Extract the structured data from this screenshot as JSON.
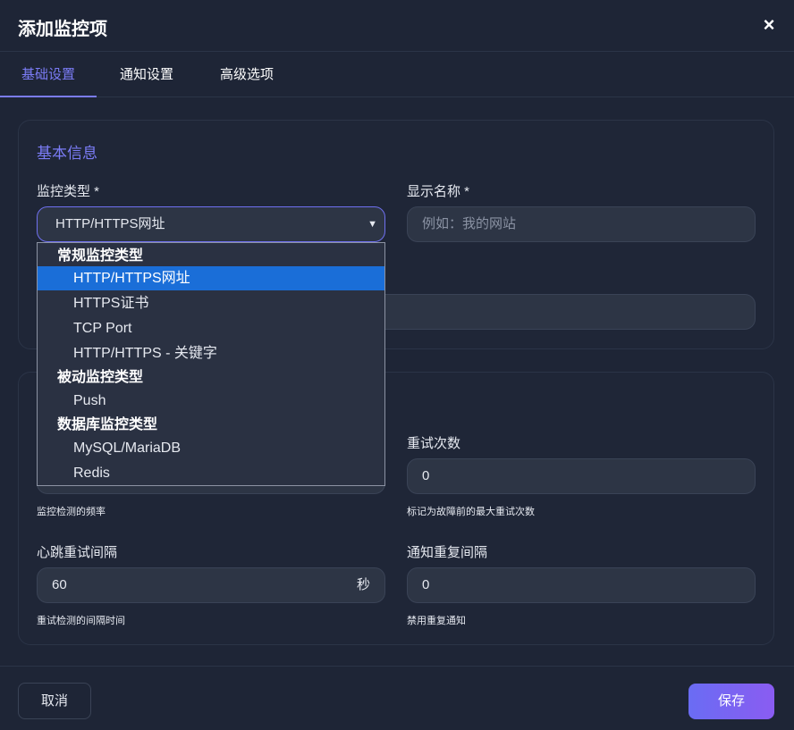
{
  "dialog": {
    "title": "添加监控项",
    "close_label": "×"
  },
  "tabs": [
    {
      "label": "基础设置",
      "active": true
    },
    {
      "label": "通知设置",
      "active": false
    },
    {
      "label": "高级选项",
      "active": false
    }
  ],
  "basic_info": {
    "section_title": "基本信息",
    "monitor_type_label": "监控类型 *",
    "monitor_type_value": "HTTP/HTTPS网址",
    "display_name_label": "显示名称 *",
    "display_name_placeholder": "例如：我的网站"
  },
  "dropdown": {
    "groups": [
      {
        "label": "常规监控类型",
        "options": [
          "HTTP/HTTPS网址",
          "HTTPS证书",
          "TCP Port",
          "HTTP/HTTPS - 关键字"
        ]
      },
      {
        "label": "被动监控类型",
        "options": [
          "Push"
        ]
      },
      {
        "label": "数据库监控类型",
        "options": [
          "MySQL/MariaDB",
          "Redis"
        ]
      }
    ],
    "selected": "HTTP/HTTPS网址"
  },
  "check_settings": {
    "interval_hint": "监控检测的频率",
    "retries_label": "重试次数",
    "retries_value": "0",
    "retries_hint": "标记为故障前的最大重试次数",
    "retry_interval_label": "心跳重试间隔",
    "retry_interval_value": "60",
    "retry_interval_unit": "秒",
    "retry_interval_hint": "重试检测的间隔时间",
    "resend_interval_label": "通知重复间隔",
    "resend_interval_value": "0",
    "resend_interval_hint": "禁用重复通知"
  },
  "footer": {
    "cancel_label": "取消",
    "save_label": "保存"
  },
  "colors": {
    "background": "#1e2536",
    "accent": "#7b7cf6",
    "selected_option": "#1a6ed8"
  }
}
